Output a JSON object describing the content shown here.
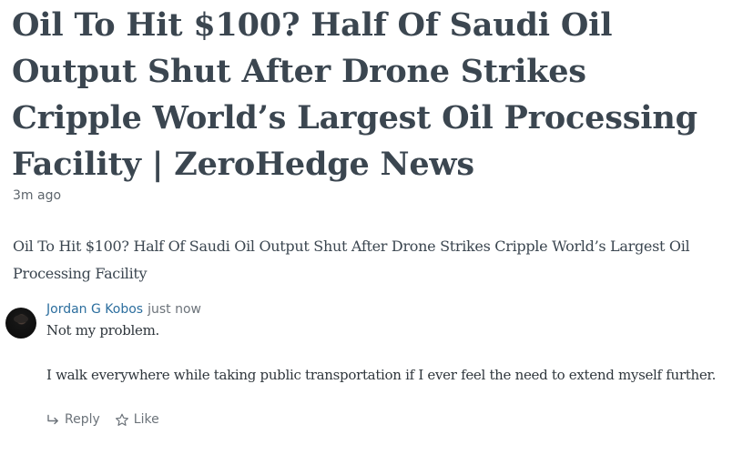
{
  "post": {
    "title": "Oil To Hit $100? Half Of Saudi Oil Output Shut After Drone Strikes Cripple World’s Largest Oil Processing Facility | ZeroHedge News",
    "time": "3m ago",
    "summary": "Oil To Hit $100? Half Of Saudi Oil Output Shut After Drone Strikes Cripple World’s Largest Oil Processing Facility"
  },
  "comment": {
    "author": "Jordan G Kobos",
    "time": "just now",
    "paragraphs": [
      "Not my problem.",
      "I walk everywhere while taking public transportation if I ever feel the need to extend myself further."
    ],
    "actions": {
      "reply_label": "Reply",
      "reply_icon": "reply-arrow-icon",
      "like_label": "Like",
      "like_icon": "star-outline-icon"
    }
  },
  "colors": {
    "headline": "#3b4650",
    "author_link": "#2c6e9e",
    "muted": "#6c737a"
  }
}
